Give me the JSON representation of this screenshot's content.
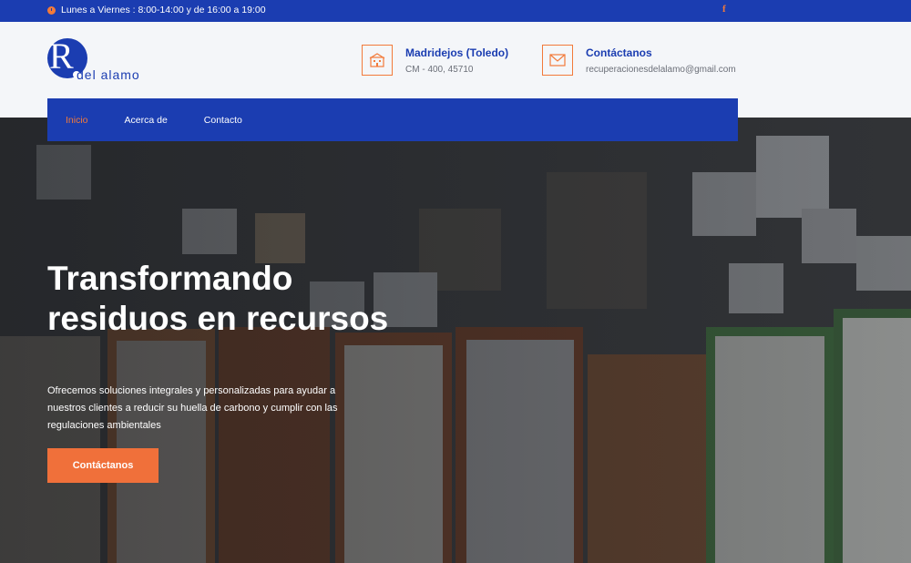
{
  "topbar": {
    "hours": "Lunes a Viernes : 8:00-14:00 y de 16:00 a 19:00",
    "social_icon": "f"
  },
  "logo": {
    "letter": "R",
    "name": "del alamo"
  },
  "header": {
    "location": {
      "title": "Madridejos (Toledo)",
      "subtitle": "CM - 400, 45710",
      "icon": "building-icon"
    },
    "contact": {
      "title": "Contáctanos",
      "subtitle": "recuperacionesdelalamo@gmail.com",
      "icon": "envelope-icon"
    }
  },
  "nav": {
    "items": [
      "Inicio",
      "Acerca de",
      "Contacto"
    ],
    "active": "Inicio"
  },
  "hero": {
    "title": "Transformando residuos en recursos",
    "description": "Ofrecemos soluciones integrales y personalizadas para ayudar a nuestros clientes a reducir su huella de carbono y cumplir con las regulaciones ambientales",
    "cta_label": "Contáctanos"
  },
  "colors": {
    "primary": "#1b3db1",
    "accent": "#f27a3a",
    "header_bg": "#f4f6f9"
  }
}
